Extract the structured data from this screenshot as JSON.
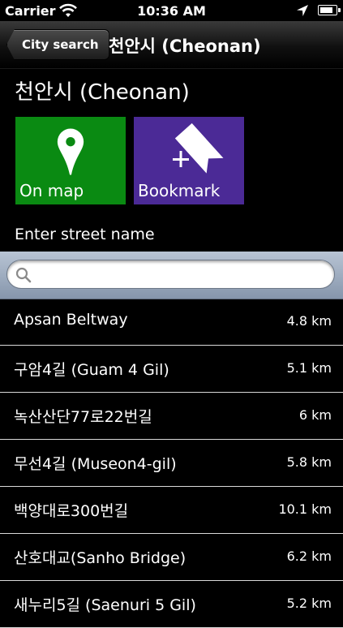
{
  "status_bar": {
    "carrier": "Carrier",
    "time": "10:36 AM",
    "battery_level": 0.85
  },
  "nav": {
    "back_label": "City search",
    "title": "천안시 (Cheonan)"
  },
  "city_heading": "천안시 (Cheonan)",
  "tiles": {
    "map_label": "On map",
    "map_color": "#0a8a12",
    "bookmark_label": "Bookmark",
    "bookmark_color": "#4b2a96"
  },
  "street_prompt": "Enter street name",
  "search": {
    "value": "",
    "placeholder": ""
  },
  "streets": [
    {
      "name": "Apsan Beltway",
      "distance": "4.8 km"
    },
    {
      "name": "구암4길 (Guam 4 Gil)",
      "distance": "5.1 km"
    },
    {
      "name": "녹산산단77로22번길",
      "distance": "6 km"
    },
    {
      "name": "무선4길 (Museon4-gil)",
      "distance": "5.8 km"
    },
    {
      "name": "백양대로300번길",
      "distance": "10.1 km"
    },
    {
      "name": "산호대교(Sanho Bridge)",
      "distance": "6.2 km"
    },
    {
      "name": "새누리5길 (Saenuri 5 Gil)",
      "distance": "5.2 km"
    }
  ],
  "icons": {
    "map_pin": "map-pin-icon",
    "bookmark_add": "bookmark-add-icon",
    "search": "search-icon",
    "wifi": "wifi-icon",
    "location": "location-arrow-icon",
    "battery": "battery-icon"
  }
}
